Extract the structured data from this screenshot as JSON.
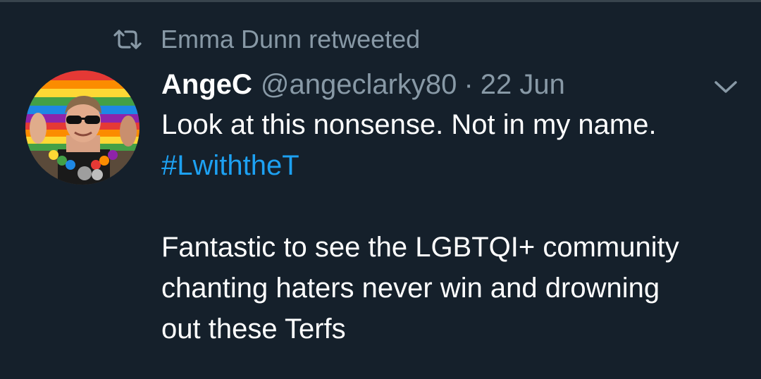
{
  "retweet": {
    "icon": "retweet-icon",
    "text": "Emma Dunn retweeted"
  },
  "tweet": {
    "author_name": "AngeC",
    "handle": "@angeclarky80",
    "separator": "·",
    "date": "22 Jun",
    "menu_icon": "chevron-down-icon",
    "avatar_icon": "avatar",
    "lines": {
      "line1": "Look at this nonsense. Not in my name.",
      "hashtag": "#LwiththeT",
      "line3": "Fantastic to see the LGBTQI+ community",
      "line4": "chanting haters never win and drowning",
      "line5": "out these Terfs"
    }
  },
  "colors": {
    "background": "#15202b",
    "secondary_text": "#8899a6",
    "primary_text": "#ffffff",
    "link": "#1da1f2",
    "divider": "#38444d"
  }
}
